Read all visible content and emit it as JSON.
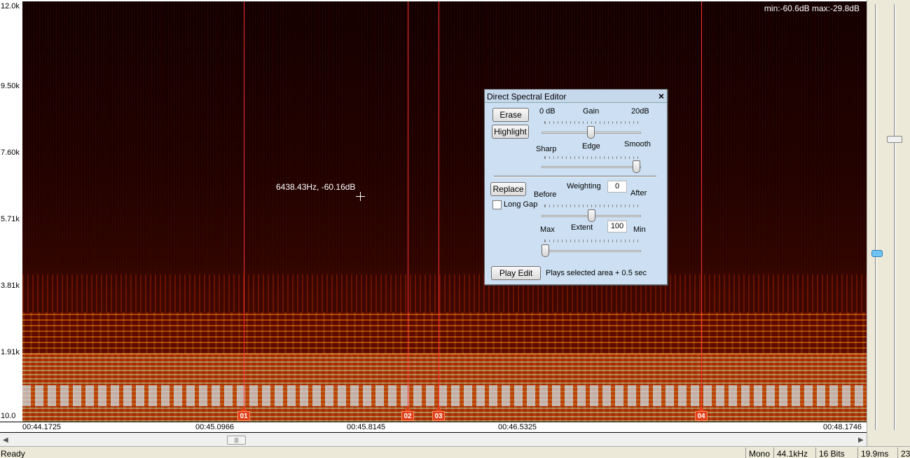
{
  "freq_axis": {
    "labels": [
      "12.0k",
      "9.50k",
      "7.60k",
      "5.71k",
      "3.81k",
      "1.91k",
      "10.0"
    ]
  },
  "spectrogram": {
    "minmax": "min:-60.6dB  max:-29.8dB",
    "cursor_readout": "6438.43Hz, -60.16dB",
    "markers": [
      "01",
      "02",
      "03",
      "04"
    ]
  },
  "time_axis": {
    "labels": [
      "00:44.1725",
      "00:45.0966",
      "00:45.8145",
      "00:46.5325",
      "00:48.1746"
    ]
  },
  "dialog": {
    "title": "Direct Spectral Editor",
    "erase": "Erase",
    "highlight": "Highlight",
    "gain_min": "0 dB",
    "gain_label": "Gain",
    "gain_max": "20dB",
    "edge_min": "Sharp",
    "edge_label": "Edge",
    "edge_max": "Smooth",
    "replace": "Replace",
    "before": "Before",
    "weighting_label": "Weighting",
    "weighting_value": "0",
    "after": "After",
    "long_gap": "Long Gap",
    "extent_max": "Max",
    "extent_label": "Extent",
    "extent_value": "100",
    "extent_min": "Min",
    "play_edit": "Play Edit",
    "play_note": "Plays selected area + 0.5 sec"
  },
  "status": {
    "ready": "Ready",
    "channels": "Mono",
    "rate": "44.1kHz",
    "bits": "16 Bits",
    "duration": "19.9ms",
    "extra": "23"
  }
}
